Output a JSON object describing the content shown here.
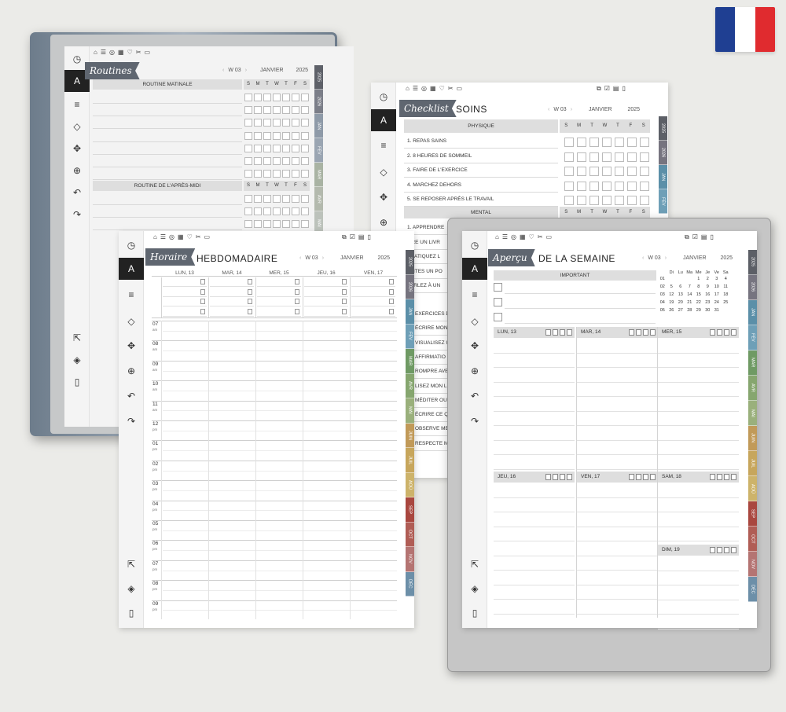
{
  "flag": {
    "colors": [
      "#1f3f92",
      "#ffffff",
      "#e02b2f"
    ]
  },
  "icons": {
    "top_left": [
      "home-icon",
      "list-icon",
      "target-icon",
      "calendar-icon",
      "heart-icon",
      "tools-icon",
      "note-icon"
    ],
    "top_right": [
      "pages-icon",
      "checklist-icon",
      "notes-icon",
      "book-icon"
    ],
    "sidebar_top": [
      "clock-icon",
      "pen-icon",
      "lines-icon",
      "eraser-icon",
      "move-icon",
      "zoom-icon",
      "undo-icon",
      "redo-icon"
    ],
    "sidebar_bottom": [
      "share-icon",
      "layers-icon",
      "book-icon"
    ]
  },
  "routines": {
    "ribbon": "Routines",
    "nav": {
      "week": "W 03",
      "month": "JANVIER",
      "year": "2025"
    },
    "section1": "ROUTINE MATINALE",
    "section2": "ROUTINE DE L'APRÈS-MIDI",
    "days": [
      "S",
      "M",
      "T",
      "W",
      "T",
      "F",
      "S"
    ],
    "tabs": [
      {
        "label": "2025",
        "color": "#5e6169"
      },
      {
        "label": "2026",
        "color": "#7b7e88"
      },
      {
        "label": "JAN",
        "color": "#8e9aa8"
      },
      {
        "label": "FÉV",
        "color": "#9aa5b2"
      },
      {
        "label": "MAR",
        "color": "#a9b3a3"
      },
      {
        "label": "AVR",
        "color": "#b3b9ad"
      },
      {
        "label": "MAI",
        "color": "#bcc2bb"
      }
    ]
  },
  "soins": {
    "ribbon": "Checklist",
    "title": "SOINS",
    "nav": {
      "week": "W 03",
      "month": "JANVIER",
      "year": "2025"
    },
    "section1": "PHYSIQUE",
    "section2": "MENTAL",
    "days": [
      "S",
      "M",
      "T",
      "W",
      "T",
      "F",
      "S"
    ],
    "physique": [
      "1. REPAS SAINS",
      "2. 8 HEURES DE SOMMEIL",
      "3. FAIRE DE L'EXERCICE",
      "4. MARCHEZ DEHORS",
      "5. SE REPOSER APRÈS LE TRAVAIL"
    ],
    "mental": [
      "1. APPRENDRE",
      "LIRE UN LIVR",
      "PRATIQUEZ L",
      "FAITES UN PO",
      "PARLEZ À UN"
    ],
    "extras": [
      "EXERCICES D",
      "ÉCRIRE MON",
      "VISUALISEZ U",
      "AFFIRMATIO",
      "ROMPRE AVE",
      "LISEZ MON L",
      "MÉDITER OU",
      "ÉCRIRE CE Q",
      "OBSERVE ME",
      "RESPECTE M"
    ]
  },
  "horaire": {
    "ribbon": "Horaire",
    "title": "HEBDOMADAIRE",
    "nav": {
      "week": "W 03",
      "month": "JANVIER",
      "year": "2025"
    },
    "days": [
      "LUN, 13",
      "MAR, 14",
      "MER, 15",
      "JEU, 16",
      "VEN, 17"
    ],
    "hours": [
      {
        "h": "07",
        "p": "am"
      },
      {
        "h": "08",
        "p": "am"
      },
      {
        "h": "09",
        "p": "am"
      },
      {
        "h": "10",
        "p": "am"
      },
      {
        "h": "11",
        "p": "am"
      },
      {
        "h": "12",
        "p": "pm"
      },
      {
        "h": "01",
        "p": "pm"
      },
      {
        "h": "02",
        "p": "pm"
      },
      {
        "h": "03",
        "p": "pm"
      },
      {
        "h": "04",
        "p": "pm"
      },
      {
        "h": "05",
        "p": "pm"
      },
      {
        "h": "06",
        "p": "pm"
      },
      {
        "h": "07",
        "p": "pm"
      },
      {
        "h": "08",
        "p": "pm"
      },
      {
        "h": "09",
        "p": "pm"
      }
    ]
  },
  "apercu": {
    "ribbon": "Aperçu",
    "title": "DE LA SEMAINE",
    "nav": {
      "week": "W 03",
      "month": "JANVIER",
      "year": "2025"
    },
    "important": "IMPORTANT",
    "cal_head": [
      "Di",
      "Lu",
      "Ma",
      "Me",
      "Je",
      "Ve",
      "Sa"
    ],
    "cal_rows": [
      [
        "01",
        "",
        "",
        "",
        "1",
        "2",
        "3",
        "4"
      ],
      [
        "02",
        "5",
        "6",
        "7",
        "8",
        "9",
        "10",
        "11"
      ],
      [
        "03",
        "12",
        "13",
        "14",
        "15",
        "16",
        "17",
        "18"
      ],
      [
        "04",
        "19",
        "20",
        "21",
        "22",
        "23",
        "24",
        "25"
      ],
      [
        "05",
        "26",
        "27",
        "28",
        "29",
        "30",
        "31",
        ""
      ]
    ],
    "days_top": [
      "LUN, 13",
      "MAR, 14",
      "MER, 15"
    ],
    "days_mid": [
      "JEU, 16",
      "VEN, 17",
      "SAM, 18"
    ],
    "day_sun": "DIM, 19"
  },
  "month_tabs": [
    {
      "label": "2025",
      "color": "#5c5f66"
    },
    {
      "label": "2026",
      "color": "#76747f"
    },
    {
      "label": "JAN",
      "color": "#5b8fa8"
    },
    {
      "label": "FÉV",
      "color": "#6e9fb7"
    },
    {
      "label": "MAR",
      "color": "#6f9a64"
    },
    {
      "label": "AVR",
      "color": "#86a66f"
    },
    {
      "label": "MAI",
      "color": "#9ab07c"
    },
    {
      "label": "JUIN",
      "color": "#c19a59"
    },
    {
      "label": "JUIL",
      "color": "#c7a65c"
    },
    {
      "label": "AOÛ",
      "color": "#cdb36a"
    },
    {
      "label": "SEP",
      "color": "#a9473f"
    },
    {
      "label": "OCT",
      "color": "#b05d55"
    },
    {
      "label": "NOV",
      "color": "#b47472"
    },
    {
      "label": "DÉC",
      "color": "#6c8fa8"
    }
  ]
}
